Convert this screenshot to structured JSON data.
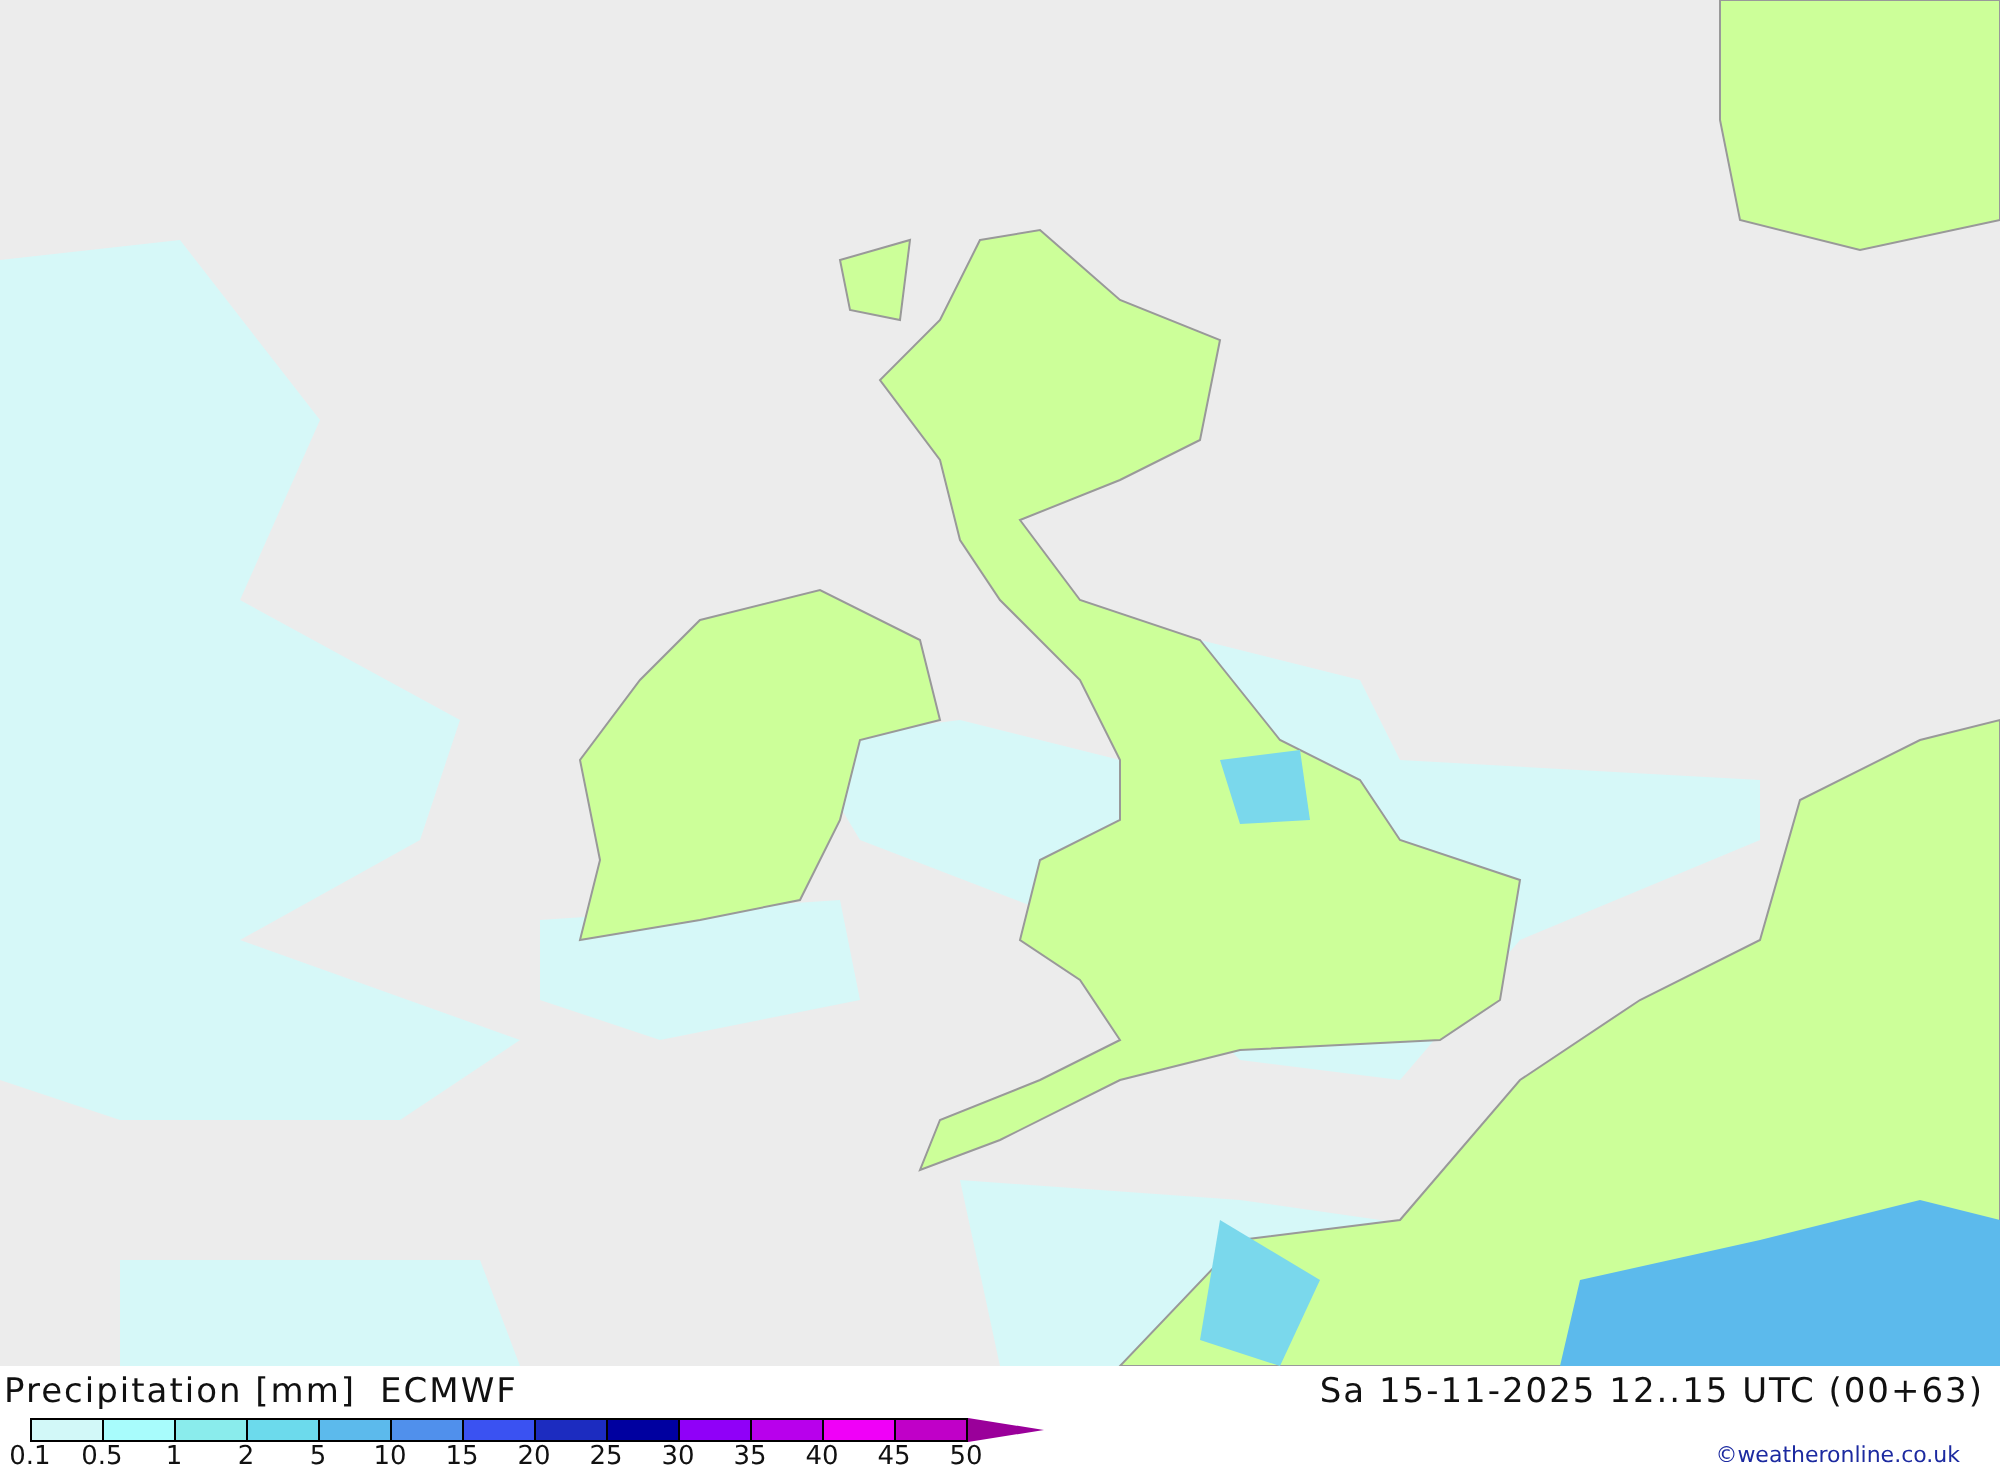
{
  "title": "Precipitation [mm]",
  "model": "ECMWF",
  "valid_time": "Sa 15-11-2025 12..15 UTC (00+63)",
  "credit": "©weatheronline.co.uk",
  "legend": {
    "bins": [
      {
        "color": "#d2f8f8"
      },
      {
        "color": "#a8fcfc"
      },
      {
        "color": "#8aecec"
      },
      {
        "color": "#6cdaec"
      },
      {
        "color": "#5cbaec"
      },
      {
        "color": "#5090ec"
      },
      {
        "color": "#3a52f2"
      },
      {
        "color": "#1c2cc0"
      },
      {
        "color": "#0000a0"
      },
      {
        "color": "#9000f8"
      },
      {
        "color": "#b800ec"
      },
      {
        "color": "#f000f8"
      },
      {
        "color": "#c000c8"
      },
      {
        "kind": "arrow",
        "color": "#9a009a"
      }
    ],
    "labels": [
      "0.1",
      "0.5",
      "1",
      "2",
      "5",
      "10",
      "15",
      "20",
      "25",
      "30",
      "35",
      "40",
      "45",
      "50"
    ]
  }
}
